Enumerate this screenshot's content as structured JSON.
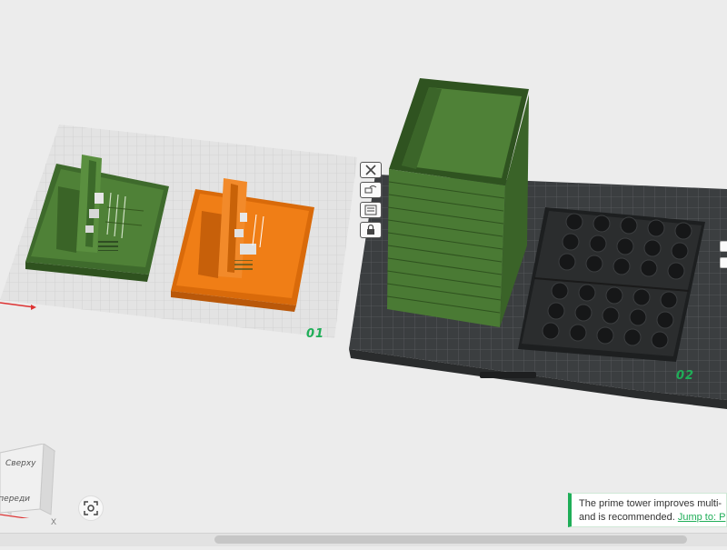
{
  "scene": {
    "plates": [
      {
        "label": "01",
        "state": "unselected"
      },
      {
        "label": "02",
        "state": "active"
      }
    ],
    "colors": {
      "green_model": "#4a7a34",
      "orange_model": "#ef7a12",
      "light_plate": "#dcdcdc",
      "dark_plate": "#3b3e40",
      "accent": "#1fae58"
    }
  },
  "plate_tools": [
    {
      "icon": "close-icon"
    },
    {
      "icon": "auto-arrange-icon"
    },
    {
      "icon": "plate-settings-icon"
    },
    {
      "icon": "lock-icon"
    }
  ],
  "nav_cube": {
    "top_label": "Сверху",
    "front_label": "Спереди",
    "axis_x": "X"
  },
  "toast": {
    "line1": "The prime tower improves multi-",
    "line2": "and is recommended.",
    "link": "Jump to: P"
  }
}
